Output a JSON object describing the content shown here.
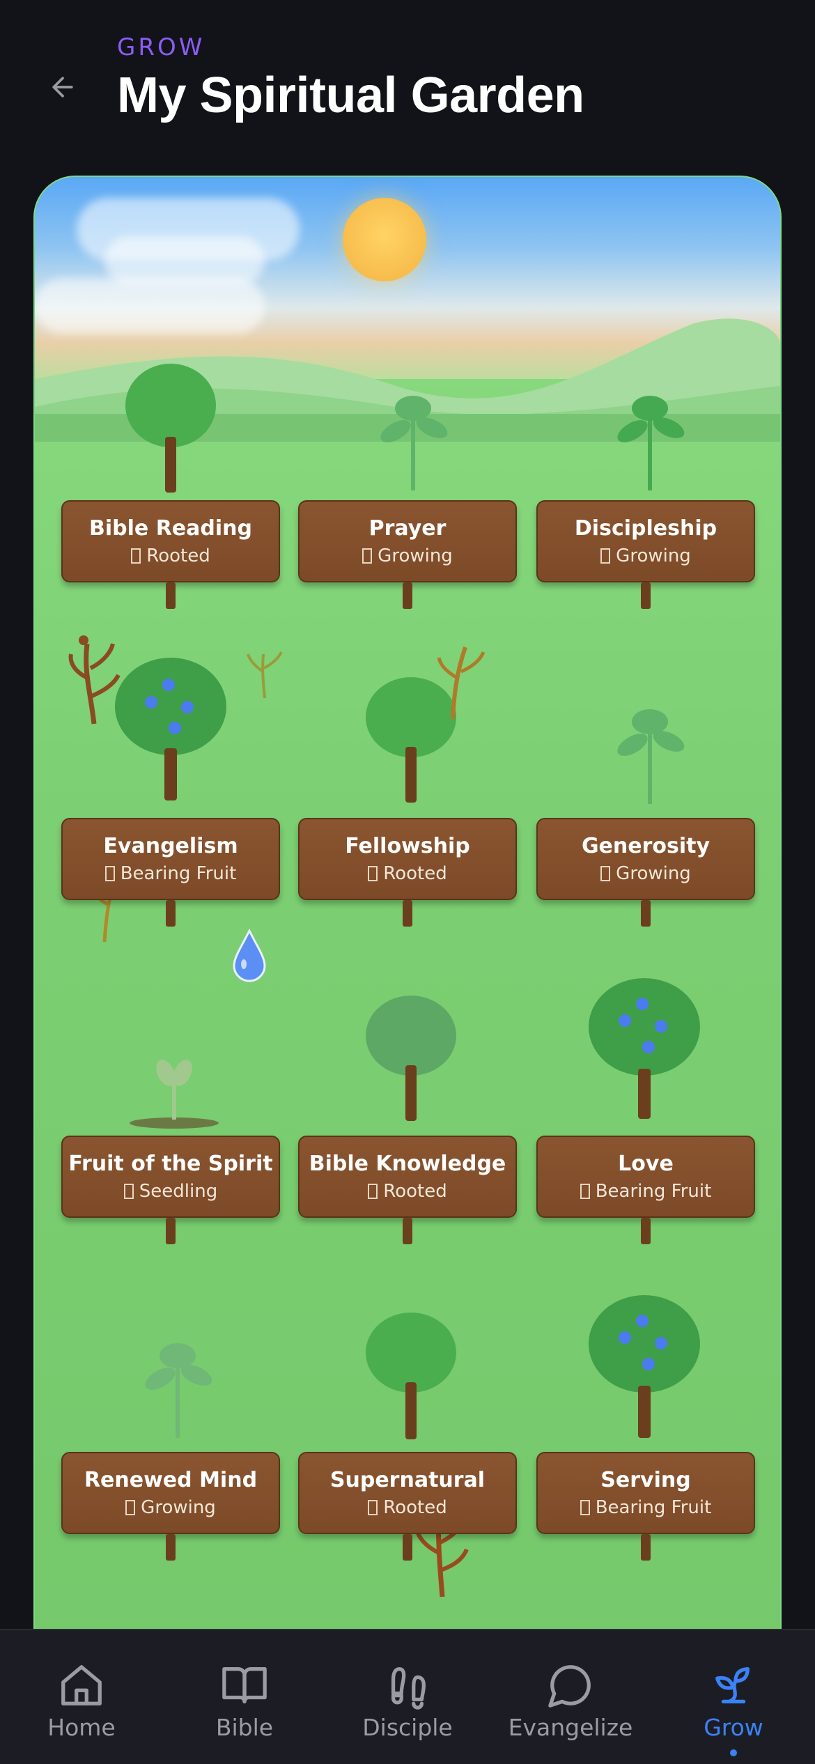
{
  "header": {
    "section_label": "GROW",
    "title": "My Spiritual Garden",
    "back_icon": "arrow-left-icon"
  },
  "colors": {
    "accent": "#8b5cf6",
    "active_nav": "#3b82f6",
    "sign_wood": "#7d4a28",
    "background": "#121318"
  },
  "garden": {
    "plants": [
      {
        "name": "Bible Reading",
        "status": "Rooted"
      },
      {
        "name": "Prayer",
        "status": "Growing"
      },
      {
        "name": "Discipleship",
        "status": "Growing"
      },
      {
        "name": "Evangelism",
        "status": "Bearing Fruit"
      },
      {
        "name": "Fellowship",
        "status": "Rooted"
      },
      {
        "name": "Generosity",
        "status": "Growing"
      },
      {
        "name": "Fruit of the Spirit",
        "status": "Seedling"
      },
      {
        "name": "Bible Knowledge",
        "status": "Rooted"
      },
      {
        "name": "Love",
        "status": "Bearing Fruit"
      },
      {
        "name": "Renewed Mind",
        "status": "Growing"
      },
      {
        "name": "Supernatural",
        "status": "Rooted"
      },
      {
        "name": "Serving",
        "status": "Bearing Fruit"
      }
    ]
  },
  "nav": {
    "items": [
      {
        "label": "Home",
        "icon": "home-icon"
      },
      {
        "label": "Bible",
        "icon": "book-icon"
      },
      {
        "label": "Disciple",
        "icon": "footprints-icon"
      },
      {
        "label": "Evangelize",
        "icon": "chat-bubble-icon"
      },
      {
        "label": "Grow",
        "icon": "sprout-icon"
      }
    ],
    "active": "Grow"
  }
}
